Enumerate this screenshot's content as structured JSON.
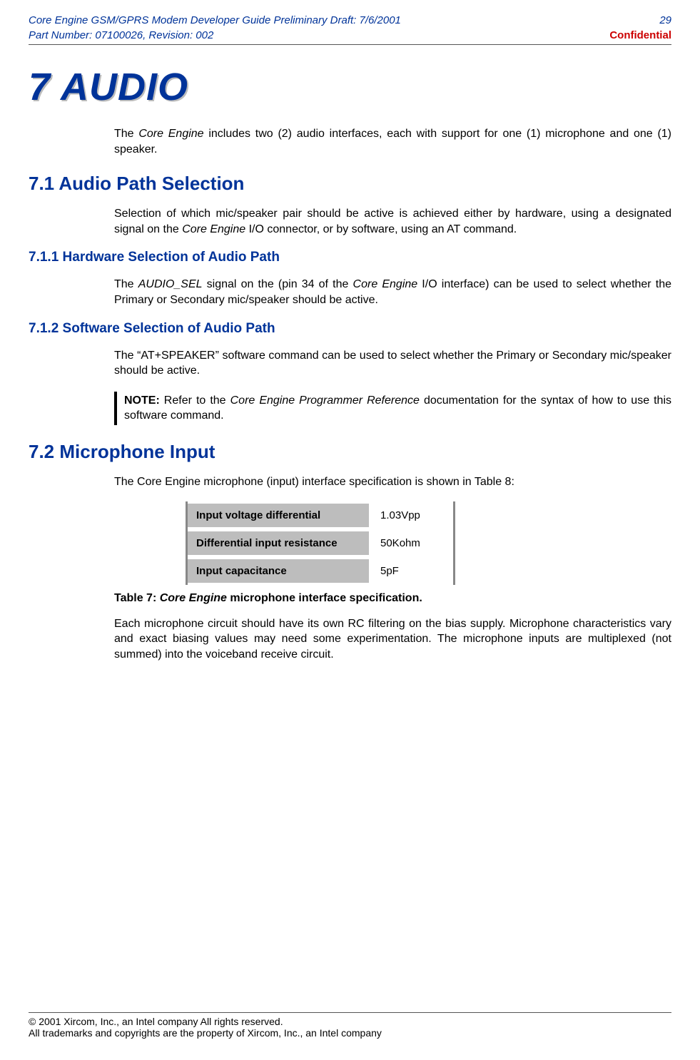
{
  "header": {
    "doc_title_left": "Core Engine GSM/GPRS Modem Developer Guide Preliminary Draft: 7/6/2001",
    "part_line": "Part Number: 07100026, Revision: 002",
    "page_no": "29",
    "confidential": "Confidential"
  },
  "chapter": {
    "title": "7 AUDIO"
  },
  "intro": {
    "p1a": "The ",
    "p1b": "Core Engine",
    "p1c": " includes two (2) audio interfaces, each with support for one (1) microphone and one (1) speaker."
  },
  "s71": {
    "title": "7.1 Audio Path Selection",
    "p1a": "Selection of which mic/speaker pair should be active is achieved either by hardware, using a designated signal on the ",
    "p1b": "Core Engine",
    "p1c": " I/O connector, or by software, using an AT command."
  },
  "s711": {
    "title": "7.1.1 Hardware Selection of Audio Path",
    "p1a": "The ",
    "p1b": "AUDIO_SEL",
    "p1c": " signal on the (pin 34 of the ",
    "p1d": "Core Engine",
    "p1e": " I/O interface) can be used to select whether the Primary or Secondary mic/speaker should be active."
  },
  "s712": {
    "title": "7.1.2 Software Selection of Audio Path",
    "p1": "The “AT+SPEAKER” software command can be used to select whether the Primary or Secondary mic/speaker should be active.",
    "note_label": "NOTE:",
    "note_a": " Refer to the ",
    "note_b": "Core Engine Programmer Reference",
    "note_c": " documentation for the syntax of how to use this software command."
  },
  "s72": {
    "title": "7.2 Microphone Input",
    "p1": "The Core Engine microphone (input) interface specification is shown in Table 8:",
    "table": {
      "rows": [
        {
          "label": "Input voltage differential",
          "value": "1.03Vpp"
        },
        {
          "label": "Differential input resistance",
          "value": "50Kohm"
        },
        {
          "label": "Input capacitance",
          "value": "5pF"
        }
      ]
    },
    "caption_a": "Table 7:  ",
    "caption_b": "Core Engine",
    "caption_c": " microphone interface specification.",
    "p2": "Each microphone circuit should have its own RC filtering on the bias supply.  Microphone characteristics vary and exact biasing values may need some experimentation.  The microphone inputs are multiplexed (not summed) into the voiceband receive circuit."
  },
  "footer": {
    "line1": "© 2001 Xircom, Inc., an Intel company All rights reserved.",
    "line2": "All trademarks and copyrights are the property of Xircom, Inc., an Intel company"
  }
}
